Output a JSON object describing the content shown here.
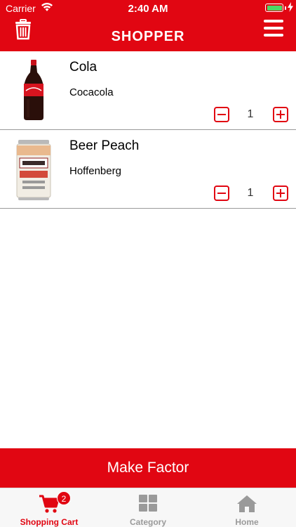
{
  "status_bar": {
    "carrier": "Carrier",
    "time": "2:40 AM"
  },
  "header": {
    "logo_text": "SHOPPER",
    "trash_icon": "trash-icon",
    "menu_icon": "hamburger-menu-icon",
    "brand_color": "#e10612"
  },
  "cart": {
    "items": [
      {
        "name": "Cola",
        "brand": "Cocacola",
        "quantity": "1",
        "image": "cola-bottle"
      },
      {
        "name": "Beer Peach",
        "brand": "Hoffenberg",
        "quantity": "1",
        "image": "beer-can"
      }
    ]
  },
  "actions": {
    "make_factor_label": "Make Factor"
  },
  "tabs": [
    {
      "label": "Shopping Cart",
      "icon": "cart-icon",
      "badge": "2",
      "active": true
    },
    {
      "label": "Category",
      "icon": "grid-icon",
      "active": false
    },
    {
      "label": "Home",
      "icon": "home-icon",
      "active": false
    }
  ]
}
